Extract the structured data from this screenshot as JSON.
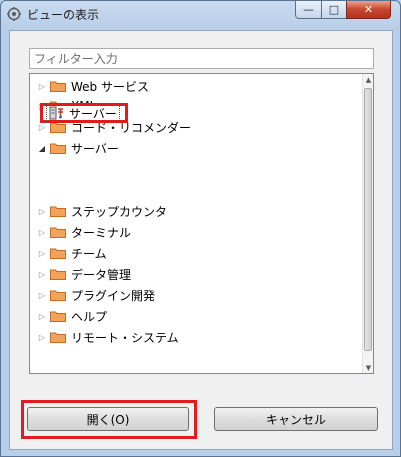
{
  "window": {
    "title": "ビューの表示"
  },
  "titlebar": {
    "min_symbol": "—",
    "max_symbol": "□",
    "close_symbol": "✕"
  },
  "filter": {
    "placeholder": "フィルター入力"
  },
  "tree": {
    "items": [
      {
        "label": "Web サービス",
        "expanded": false,
        "icon": "folder-icon"
      },
      {
        "label": "XML",
        "expanded": false,
        "icon": "folder-icon"
      },
      {
        "label": "コード・リコメンダー",
        "expanded": false,
        "icon": "folder-icon"
      },
      {
        "label": "サーバー",
        "expanded": true,
        "icon": "folder-icon",
        "children": [
          {
            "label": "サーバー",
            "icon": "server-icon",
            "selected": true
          }
        ]
      },
      {
        "label": "ステップカウンタ",
        "expanded": false,
        "icon": "folder-icon"
      },
      {
        "label": "ターミナル",
        "expanded": false,
        "icon": "folder-icon"
      },
      {
        "label": "チーム",
        "expanded": false,
        "icon": "folder-icon"
      },
      {
        "label": "データ管理",
        "expanded": false,
        "icon": "folder-icon"
      },
      {
        "label": "プラグイン開発",
        "expanded": false,
        "icon": "folder-icon"
      },
      {
        "label": "ヘルプ",
        "expanded": false,
        "icon": "folder-icon"
      },
      {
        "label": "リモート・システム",
        "expanded": false,
        "icon": "folder-icon"
      }
    ]
  },
  "buttons": {
    "open_label": "開く(O)",
    "cancel_label": "キャンセル"
  },
  "colors": {
    "highlight": "#e21c1c",
    "folder": "#e8833a"
  }
}
